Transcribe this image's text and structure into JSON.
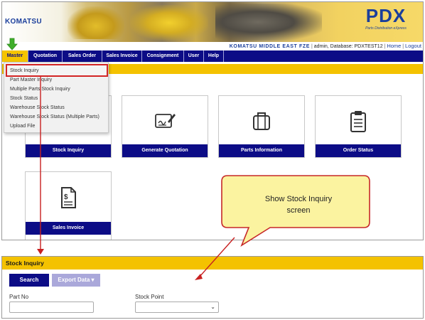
{
  "header": {
    "logo_text": "KOMATSU",
    "pdx_title": "PDX",
    "pdx_subtitle": "Parts Distribution eXpress"
  },
  "info_bar": {
    "company": "KOMATSU MIDDLE EAST FZE",
    "user_info": "admin, Database: PDXTEST12",
    "home_link": "Home",
    "logout_link": "Logout"
  },
  "nav": {
    "items": [
      "Master",
      "Quotation",
      "Sales Order",
      "Sales Invoice",
      "Consignment",
      "User",
      "Help"
    ]
  },
  "dropdown": {
    "items": [
      "Stock Inquiry",
      "Part Master Inquiry",
      "Multiple Parts Stock Inquiry",
      "Stock Status",
      "Warehouse Stock Status",
      "Warehouse Stock Status (Multiple Parts)",
      "Upload File"
    ]
  },
  "tiles": [
    "Stock Inquiry",
    "Generate Quotation",
    "Parts Information",
    "Order Status",
    "Sales Invoice"
  ],
  "callout": {
    "line1": "Show Stock Inquiry",
    "line2": "screen"
  },
  "stock_inquiry": {
    "title": "Stock Inquiry",
    "search_label": "Search",
    "export_label": "Export Data ▾",
    "part_no_label": "Part No",
    "part_no_value": "",
    "stock_point_label": "Stock Point",
    "stock_point_value": ""
  },
  "colors": {
    "nav_bg": "#0c0c86",
    "accent_yellow": "#f4c200",
    "highlight_red": "#d32525",
    "arrow_green": "#3fae2a"
  }
}
